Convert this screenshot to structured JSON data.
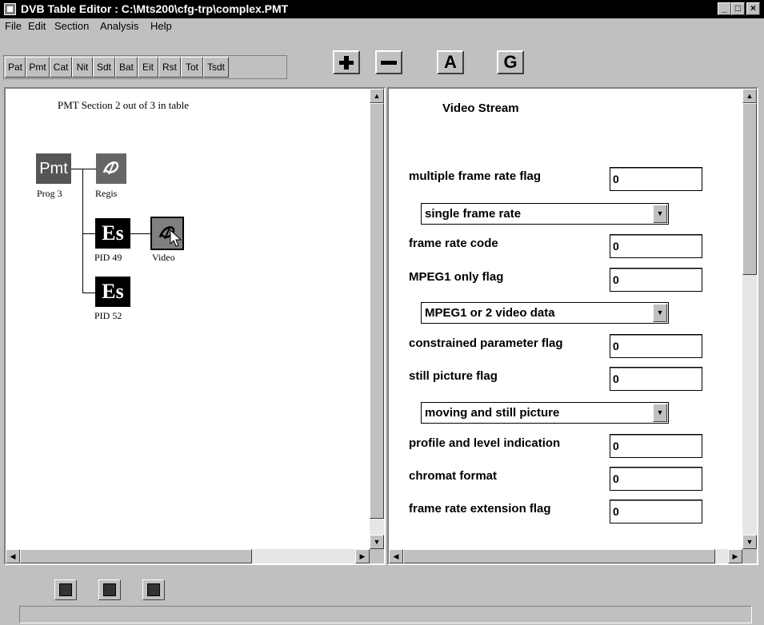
{
  "window": {
    "title": "DVB Table Editor : C:\\Mts200\\cfg-trp\\complex.PMT",
    "minimize": "_",
    "maximize": "□",
    "close": "×"
  },
  "menu": [
    "File",
    "Edit",
    "Section",
    "Analysis",
    "Help"
  ],
  "toolbar": {
    "tables": [
      "Pat",
      "Pmt",
      "Cat",
      "Nit",
      "Sdt",
      "Bat",
      "Eit",
      "Rst",
      "Tot",
      "Tsdt"
    ],
    "add_icon": "plus-icon",
    "remove_icon": "minus-icon",
    "a_label": "A",
    "g_label": "G"
  },
  "tree": {
    "caption": "PMT Section 2 out of 3 in table",
    "nodes": {
      "pmt": {
        "text": "Pmt",
        "label": "Prog 3"
      },
      "regis": {
        "label": "Regis"
      },
      "es1": {
        "text": "Es",
        "label": "PID 49"
      },
      "video": {
        "label": "Video"
      },
      "es2": {
        "text": "Es",
        "label": "PID 52"
      }
    }
  },
  "detail": {
    "title": "Video Stream",
    "fields": [
      {
        "label": "multiple frame rate flag",
        "value": "0"
      },
      {
        "label": "frame rate code",
        "value": "0"
      },
      {
        "label": "MPEG1 only flag",
        "value": "0"
      },
      {
        "label": "constrained parameter flag",
        "value": "0"
      },
      {
        "label": "still picture flag",
        "value": "0"
      },
      {
        "label": "profile and level indication",
        "value": "0"
      },
      {
        "label": "chromat format",
        "value": "0"
      },
      {
        "label": "frame rate extension flag",
        "value": "0"
      }
    ],
    "combos": [
      {
        "value": "single frame rate"
      },
      {
        "value": "MPEG1 or 2 video data"
      },
      {
        "value": "moving and still picture"
      }
    ]
  },
  "scroll_arrows": {
    "up": "▲",
    "down": "▼",
    "left": "◀",
    "right": "▶"
  },
  "status_text": ""
}
